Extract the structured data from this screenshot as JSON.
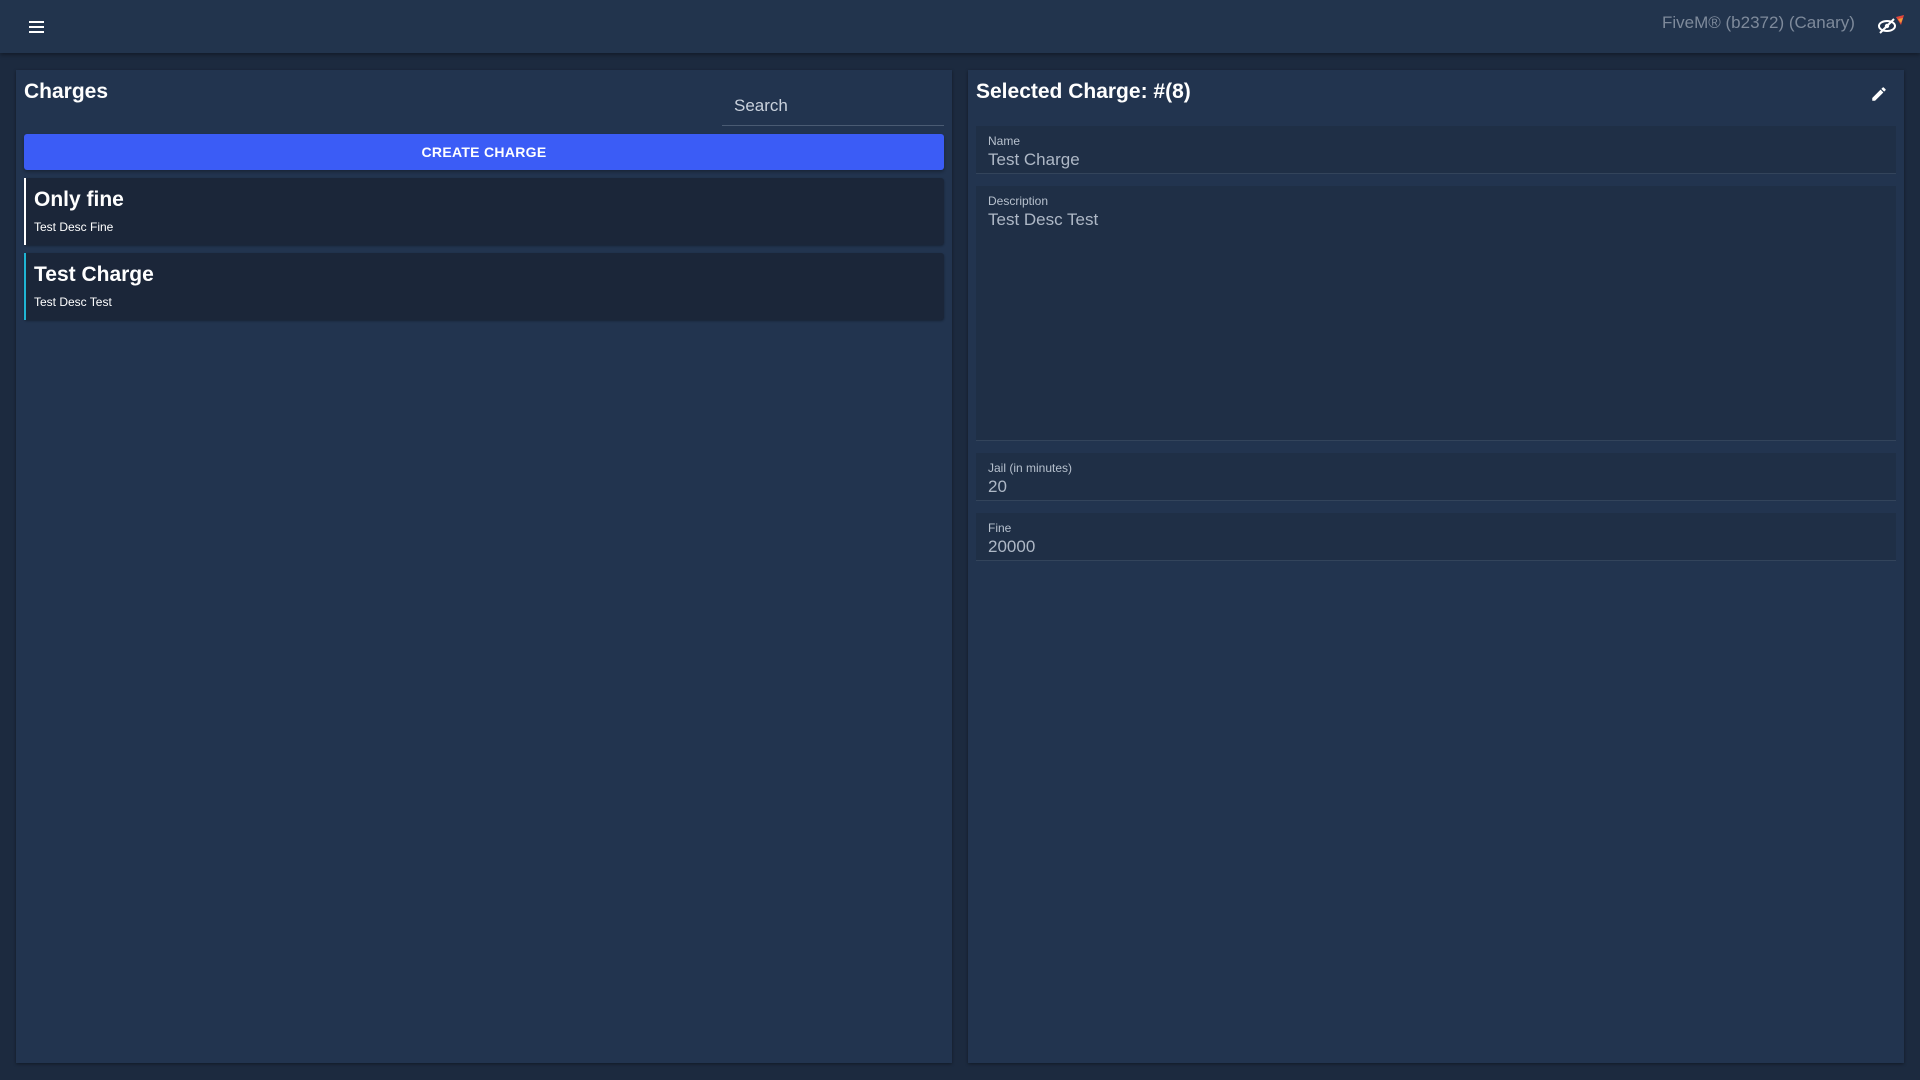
{
  "window": {
    "title": "FiveM® (b2372) (Canary)"
  },
  "left_panel": {
    "title": "Charges",
    "search_placeholder": "Search",
    "create_button": "CREATE CHARGE",
    "charges": [
      {
        "name": "Only fine",
        "description": "Test Desc Fine",
        "accent": "#ffffff"
      },
      {
        "name": "Test Charge",
        "description": "Test Desc Test",
        "accent": "#1fb5d4"
      }
    ]
  },
  "right_panel": {
    "title": "Selected Charge: #(8)",
    "fields": {
      "name": {
        "label": "Name",
        "value": "Test Charge"
      },
      "description": {
        "label": "Description",
        "value": "Test Desc Test"
      },
      "jail": {
        "label": "Jail (in minutes)",
        "value": "20"
      },
      "fine": {
        "label": "Fine",
        "value": "20000"
      }
    }
  },
  "colors": {
    "background": "#1c2a3f",
    "panel": "#22344f",
    "topbar": "#22344d",
    "primary_button": "#3b5cf6",
    "list_item": "#1b2639",
    "selected_accent": "#1fb5d4"
  },
  "icons": {
    "menu": "hamburger-menu-icon",
    "edit": "pencil-icon",
    "overlay": "hidden-eye-icon"
  }
}
